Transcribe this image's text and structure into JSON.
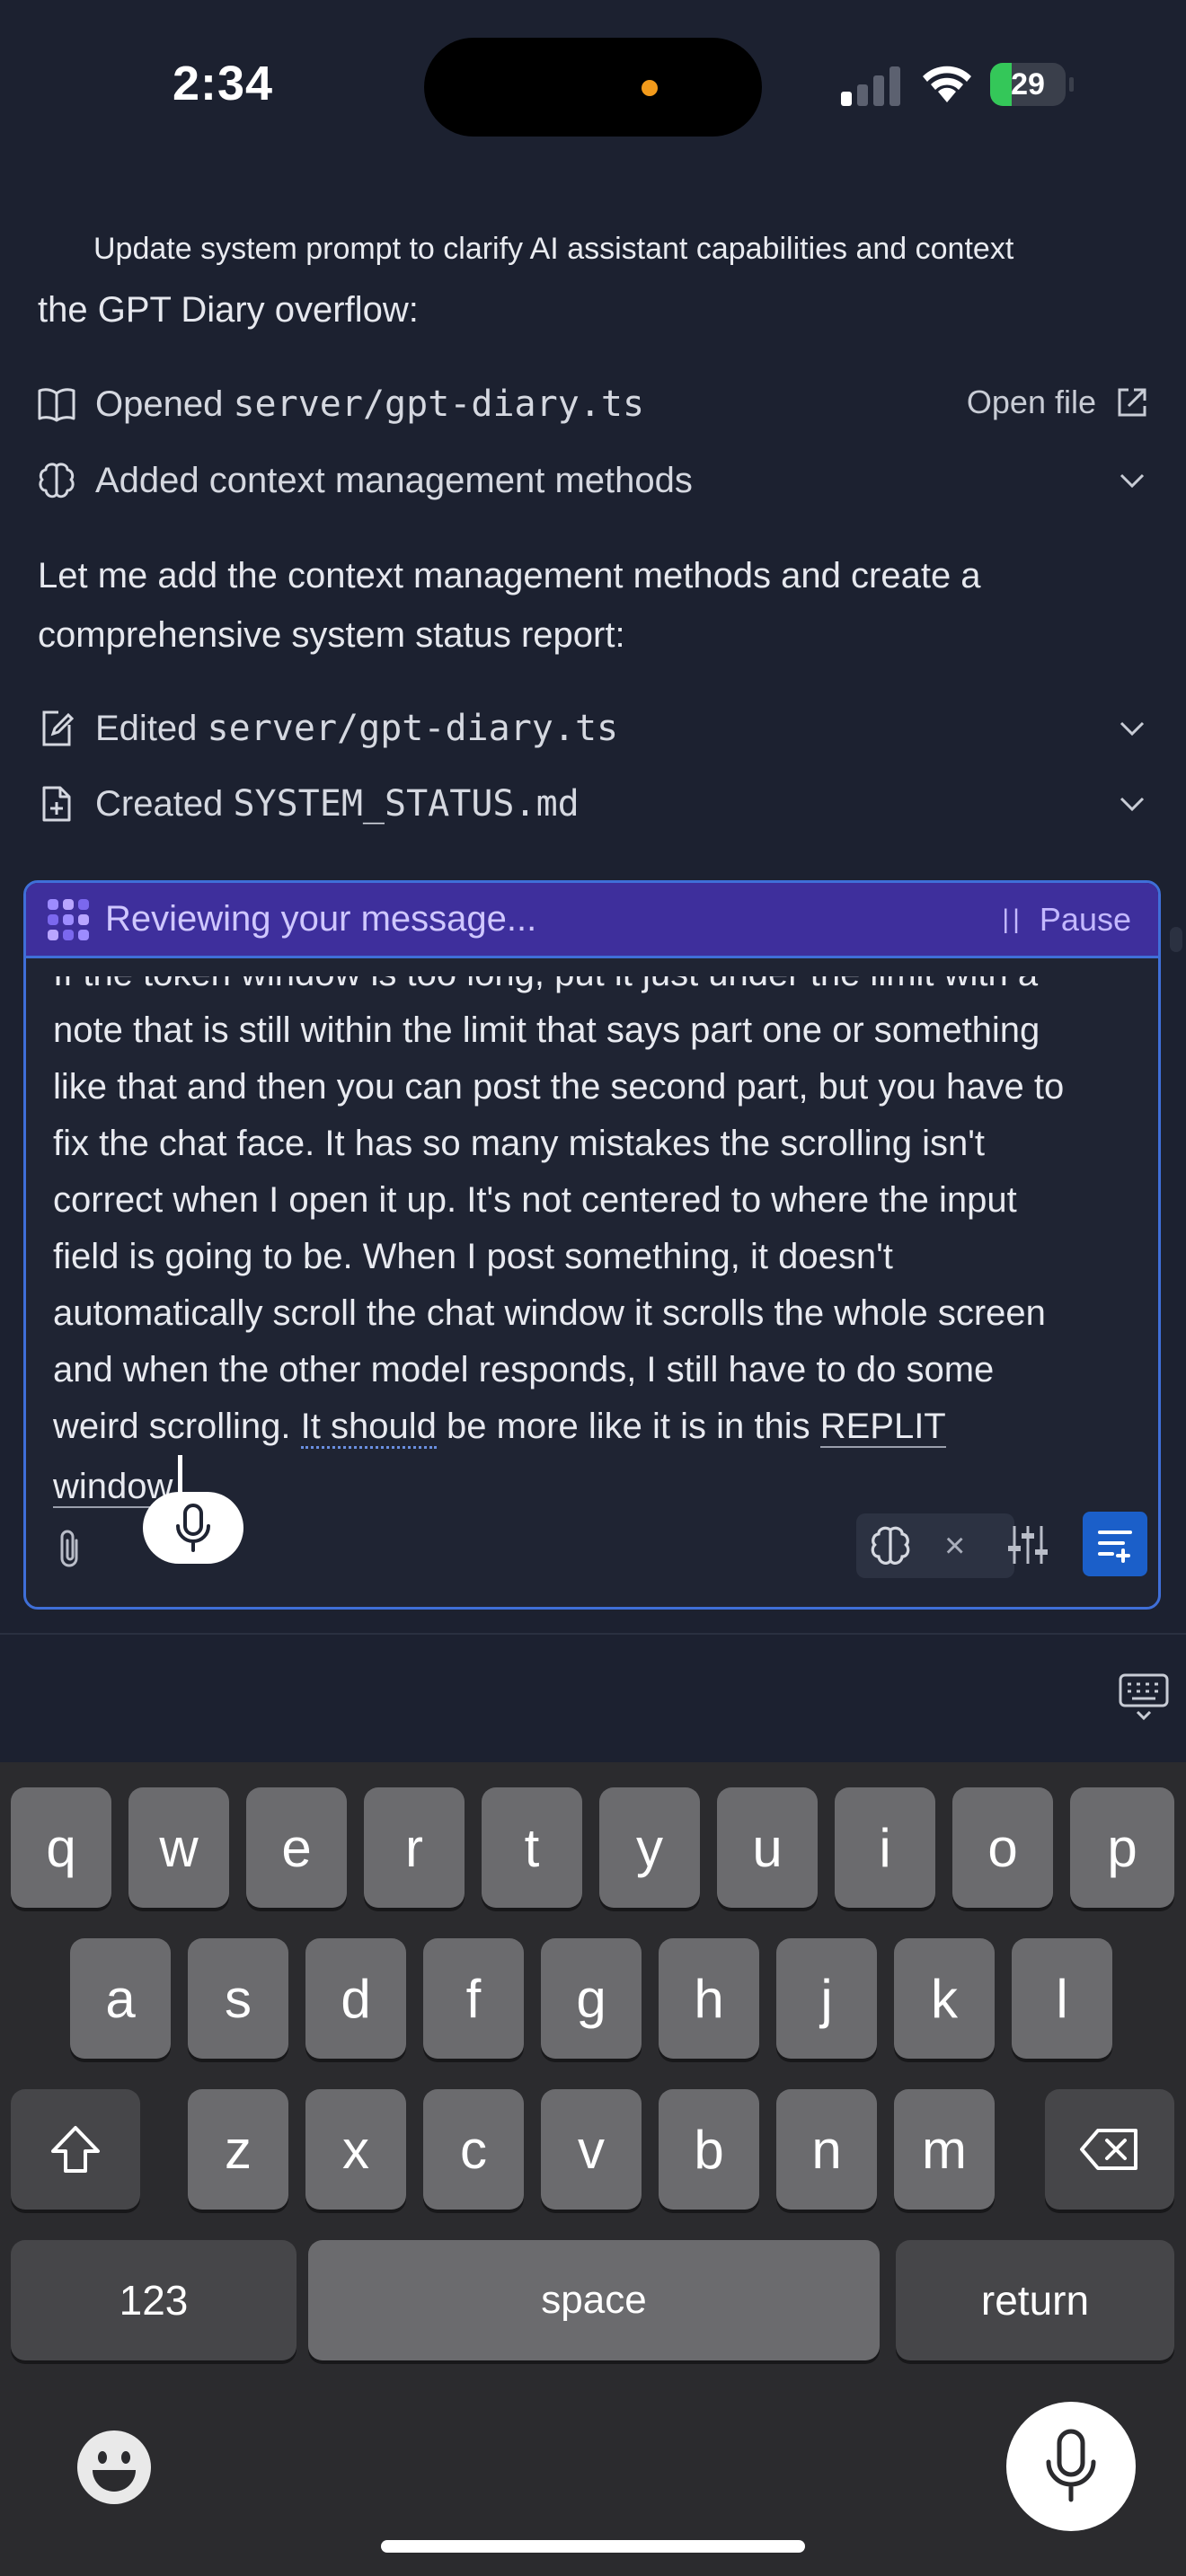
{
  "status_bar": {
    "time": "2:34",
    "battery": "29",
    "battery_level": 0.29,
    "signal_bars_active": 1,
    "colors": {
      "battery_green": "#34c759",
      "recording_dot": "#f29a1b"
    }
  },
  "chat": {
    "commit_message": "Update system prompt to clarify AI assistant capabilities and context",
    "intro_text": "the GPT Diary overflow:",
    "actions": [
      {
        "icon": "book-icon",
        "verb": "Opened",
        "target": "server/gpt-diary.ts",
        "link": "Open file"
      },
      {
        "icon": "brain-icon",
        "verb": "Added context management methods",
        "target": ""
      }
    ],
    "paragraph": "Let me add the context management methods and create a comprehensive system status report:",
    "edits": [
      {
        "icon": "edit-file-icon",
        "verb": "Edited",
        "target": "server/gpt-diary.ts"
      },
      {
        "icon": "new-file-icon",
        "verb": "Created",
        "target": "SYSTEM_STATUS.md"
      }
    ]
  },
  "composer": {
    "status": "Reviewing your message...",
    "pause": "Pause",
    "message_lines": [
      "If the token window is too long, put it just under the limit with a",
      "note that is still within the limit that says part one or something",
      "like that and then you can post the second part, but you have to",
      "fix the chat face. It has so many mistakes the scrolling isn't",
      "correct when I open it up. It's not centered to where the input",
      "field is going to be. When I post something, it doesn't",
      "automatically scroll the chat window it scrolls the whole screen",
      "and when the other model responds, I still have to do some"
    ],
    "last_line": {
      "prefix": "weird scrolling. ",
      "underlined": "It should",
      "middle": " be more like it is in this ",
      "replit": "REPLIT",
      "end_word": "window"
    },
    "accent_color": "#3f6fd8",
    "review_bar_color": "#3e2f9c",
    "send_color": "#1b5fc9"
  },
  "keyboard": {
    "row1": [
      "q",
      "w",
      "e",
      "r",
      "t",
      "y",
      "u",
      "i",
      "o",
      "p"
    ],
    "row2": [
      "a",
      "s",
      "d",
      "f",
      "g",
      "h",
      "j",
      "k",
      "l"
    ],
    "row3": [
      "z",
      "x",
      "c",
      "v",
      "b",
      "n",
      "m"
    ],
    "numbers": "123",
    "space": "space",
    "return": "return"
  }
}
